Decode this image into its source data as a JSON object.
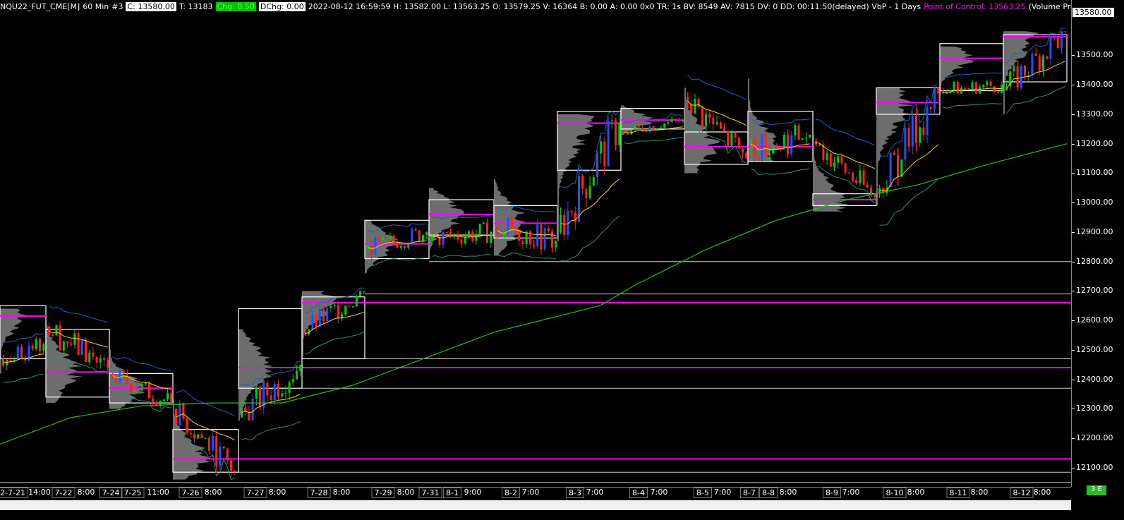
{
  "header": {
    "symbol": "NQU22_FUT_CME[M]",
    "interval": "60 Min",
    "chart_num": "#3",
    "close": "C: 13580.00",
    "trades": "T: 13183",
    "chg": "Chg: 0.50",
    "dchg": "DChg: 0.00",
    "stats": "2022-08-12 16:59:59 H: 13582.00 L: 13563.25 O: 13579.25 V: 16364 B: 0.00 A: 0.00 0x0 TR: 1s BV: 8549 AV: 7815 DV: 0 DD: 00:11:50(delayed) VbP - 1 Days",
    "poc": "Point of Control: 13563.25",
    "study": "(Volume Profiles & POC, VAH, VAL, VWA"
  },
  "last_price_label": "13580.00",
  "scroll_label": "3 E",
  "colors": {
    "background": "#000000",
    "up_candle": "#00cc00",
    "down_candle": "#ff2020",
    "strong_up": "#2050ff",
    "poc": "#ff00ff",
    "value_area": "#ffffff",
    "profile": "#808080",
    "vwap": "#ffd700",
    "bands": "#1e5fbf",
    "ma": "#20c020"
  },
  "chart_data": {
    "type": "candlestick",
    "title": "",
    "ylim": [
      12040,
      13640
    ],
    "yticks": [
      12100,
      12200,
      12300,
      12400,
      12500,
      12600,
      12700,
      12800,
      12900,
      13000,
      13100,
      13200,
      13300,
      13400,
      13500
    ],
    "ytick_labels": [
      "12100.00",
      "12200.00",
      "12300.00",
      "12400.00",
      "12500.00",
      "12600.00",
      "12700.00",
      "12800.00",
      "12900.00",
      "13000.00",
      "13100.00",
      "13200.00",
      "13300.00",
      "13400.00",
      "13500.00"
    ],
    "xticks": [
      {
        "label": "2-7-21",
        "boxed": true
      },
      {
        "label": "14:00",
        "boxed": false
      },
      {
        "label": "7-22",
        "boxed": true
      },
      {
        "label": "8:00",
        "boxed": false
      },
      {
        "label": "7-24",
        "boxed": true
      },
      {
        "label": "7-25",
        "boxed": true
      },
      {
        "label": "11:00",
        "boxed": false
      },
      {
        "label": "7-26",
        "boxed": true
      },
      {
        "label": "8:00",
        "boxed": false
      },
      {
        "label": "7-27",
        "boxed": true
      },
      {
        "label": "8:00",
        "boxed": false
      },
      {
        "label": "7-28",
        "boxed": true
      },
      {
        "label": "8:00",
        "boxed": false
      },
      {
        "label": "7-29",
        "boxed": true
      },
      {
        "label": "8:00",
        "boxed": false
      },
      {
        "label": "7-31",
        "boxed": true
      },
      {
        "label": "8-1",
        "boxed": true
      },
      {
        "label": "9:00",
        "boxed": false
      },
      {
        "label": "8-2",
        "boxed": true
      },
      {
        "label": "7:00",
        "boxed": false
      },
      {
        "label": "8-3",
        "boxed": true
      },
      {
        "label": "7:00",
        "boxed": false
      },
      {
        "label": "8-4",
        "boxed": true
      },
      {
        "label": "7:00",
        "boxed": false
      },
      {
        "label": "8-5",
        "boxed": true
      },
      {
        "label": "7:00",
        "boxed": false
      },
      {
        "label": "8-7",
        "boxed": true
      },
      {
        "label": "8-8",
        "boxed": true
      },
      {
        "label": "8:00",
        "boxed": false
      },
      {
        "label": "8-9",
        "boxed": true
      },
      {
        "label": "7:00",
        "boxed": false
      },
      {
        "label": "8-10",
        "boxed": true
      },
      {
        "label": "8:00",
        "boxed": false
      },
      {
        "label": "8-11",
        "boxed": true
      },
      {
        "label": "8:00",
        "boxed": false
      },
      {
        "label": "8-12",
        "boxed": true
      },
      {
        "label": "8:00",
        "boxed": false
      }
    ],
    "sessions": [
      {
        "label": "7-21",
        "start": 0,
        "end": 65,
        "open": 12470,
        "close": 12520,
        "high": 12640,
        "low": 12420,
        "vah": 12650,
        "val": 12470,
        "poc": 12615
      },
      {
        "label": "7-22",
        "start": 65,
        "end": 155,
        "open": 12580,
        "close": 12440,
        "high": 12600,
        "low": 12320,
        "vah": 12570,
        "val": 12340,
        "poc": 12425
      },
      {
        "label": "7-24/25",
        "start": 155,
        "end": 245,
        "open": 12420,
        "close": 12320,
        "high": 12500,
        "low": 12300,
        "vah": 12420,
        "val": 12320,
        "poc": 12370
      },
      {
        "label": "7-26",
        "start": 245,
        "end": 338,
        "open": 12300,
        "close": 12090,
        "high": 12330,
        "low": 12060,
        "vah": 12230,
        "val": 12085,
        "poc": 12130
      },
      {
        "label": "7-27",
        "start": 338,
        "end": 428,
        "open": 12270,
        "close": 12450,
        "high": 12570,
        "low": 12260,
        "vah": 12640,
        "val": 12370,
        "poc": 12440
      },
      {
        "label": "7-28",
        "start": 428,
        "end": 517,
        "open": 12560,
        "close": 12700,
        "high": 12700,
        "low": 12480,
        "vah": 12680,
        "val": 12470,
        "poc": 12660
      },
      {
        "label": "7-29",
        "start": 517,
        "end": 608,
        "open": 12840,
        "close": 12900,
        "high": 12940,
        "low": 12760,
        "vah": 12940,
        "val": 12810,
        "poc": 12860
      },
      {
        "label": "7-31/8-1",
        "start": 608,
        "end": 700,
        "open": 12880,
        "close": 12900,
        "high": 13050,
        "low": 12840,
        "vah": 13010,
        "val": 12890,
        "poc": 12960
      },
      {
        "label": "8-2",
        "start": 700,
        "end": 790,
        "open": 12920,
        "close": 12870,
        "high": 13080,
        "low": 12820,
        "vah": 12990,
        "val": 12880,
        "poc": 12930
      },
      {
        "label": "8-3",
        "start": 790,
        "end": 880,
        "open": 12900,
        "close": 13270,
        "high": 13300,
        "low": 12870,
        "vah": 13310,
        "val": 13110,
        "poc": 13270
      },
      {
        "label": "8-4",
        "start": 880,
        "end": 970,
        "open": 13240,
        "close": 13280,
        "high": 13330,
        "low": 13230,
        "vah": 13320,
        "val": 13250,
        "poc": 13280
      },
      {
        "label": "8-5",
        "start": 970,
        "end": 1060,
        "open": 13360,
        "close": 13150,
        "high": 13390,
        "low": 13100,
        "vah": 13240,
        "val": 13130,
        "poc": 13190
      },
      {
        "label": "8-7/8-8",
        "start": 1060,
        "end": 1152,
        "open": 13180,
        "close": 13230,
        "high": 13420,
        "low": 13140,
        "vah": 13310,
        "val": 13140,
        "poc": 13190
      },
      {
        "label": "8-9",
        "start": 1152,
        "end": 1242,
        "open": 13210,
        "close": 13020,
        "high": 13230,
        "low": 12970,
        "vah": 13030,
        "val": 12990,
        "poc": 13010
      },
      {
        "label": "8-10",
        "start": 1242,
        "end": 1332,
        "open": 13030,
        "close": 13370,
        "high": 13390,
        "low": 12990,
        "vah": 13390,
        "val": 13300,
        "poc": 13340
      },
      {
        "label": "8-11",
        "start": 1332,
        "end": 1422,
        "open": 13380,
        "close": 13400,
        "high": 13530,
        "low": 13370,
        "vah": 13540,
        "val": 13380,
        "poc": 13490
      },
      {
        "label": "8-12",
        "start": 1422,
        "end": 1512,
        "open": 13380,
        "close": 13580,
        "high": 13582,
        "low": 13300,
        "vah": 13570,
        "val": 13410,
        "poc": 13563
      }
    ],
    "extended_levels": [
      {
        "price": 12800,
        "kind": "va",
        "from": 608
      },
      {
        "price": 12690,
        "kind": "va",
        "from": 517
      },
      {
        "price": 12660,
        "kind": "poc",
        "from": 517
      },
      {
        "price": 12470,
        "kind": "va",
        "from": 517
      },
      {
        "price": 12440,
        "kind": "poc",
        "from": 428
      },
      {
        "price": 12370,
        "kind": "va",
        "from": 428
      },
      {
        "price": 12130,
        "kind": "poc",
        "from": 338
      },
      {
        "price": 12085,
        "kind": "va",
        "from": 338
      },
      {
        "price": 12050,
        "kind": "va",
        "from": 0
      }
    ],
    "ma_line": [
      [
        0,
        12180
      ],
      [
        100,
        12270
      ],
      [
        200,
        12310
      ],
      [
        300,
        12320
      ],
      [
        400,
        12320
      ],
      [
        500,
        12380
      ],
      [
        600,
        12470
      ],
      [
        700,
        12560
      ],
      [
        800,
        12620
      ],
      [
        850,
        12650
      ],
      [
        900,
        12720
      ],
      [
        1000,
        12840
      ],
      [
        1100,
        12940
      ],
      [
        1200,
        13010
      ],
      [
        1300,
        13060
      ],
      [
        1400,
        13130
      ],
      [
        1512,
        13200
      ]
    ]
  }
}
